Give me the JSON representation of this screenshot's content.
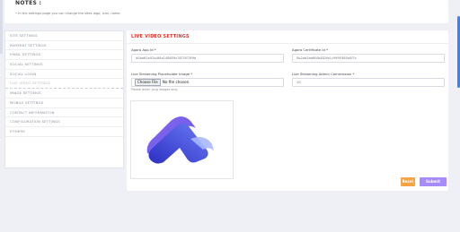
{
  "notes": {
    "title": "NOTES :",
    "text": "• In the settings page you can change the sites logo, icon, name."
  },
  "sidebar": {
    "items": [
      {
        "label": "SITE SETTINGS",
        "active": false
      },
      {
        "label": "PAYMENT SETTINGS",
        "active": false
      },
      {
        "label": "EMAIL SETTINGS",
        "active": false
      },
      {
        "label": "SOCIAL SETTINGS",
        "active": false
      },
      {
        "label": "SOCIAL LOGIN",
        "active": false
      },
      {
        "label": "LIVE VIDEO SETTINGS",
        "active": true
      },
      {
        "label": "IMAGE SETTINGS",
        "active": false
      },
      {
        "label": "MOBILE SETTINGS",
        "active": false
      },
      {
        "label": "CONTACT INFORMATION",
        "active": false
      },
      {
        "label": "CONFIGURATION SETTINGS",
        "active": false
      },
      {
        "label": "OTHERS",
        "active": false
      }
    ]
  },
  "panel": {
    "title": "LIVE VIDEO SETTINGS",
    "agora_app_id": {
      "label": "Agora App Id *",
      "value": "d0ba61e92a4f4a148659c3f27673f9d"
    },
    "agora_certificate_id": {
      "label": "Agora Certificate Id *",
      "value": "0b2ab5ad6f4b482fe1c9999365a0f7c"
    },
    "placeholder_image": {
      "label": "Live Streaming Placeholder Image *",
      "button": "Choose File",
      "status": "No file chosen",
      "hint": "Please enter .png images only."
    },
    "admin_commission": {
      "label": "Live Streaming Admin Commission *",
      "value": "10"
    },
    "reset_label": "Reset",
    "submit_label": "Submit"
  },
  "colors": {
    "title_red": "#e0362c",
    "reset": "#f5a347",
    "submit": "#a78bfa",
    "logo_blue": "#5b5ce0",
    "logo_purple": "#8e64f2"
  },
  "preview": {
    "icon": "app-logo-icon"
  }
}
